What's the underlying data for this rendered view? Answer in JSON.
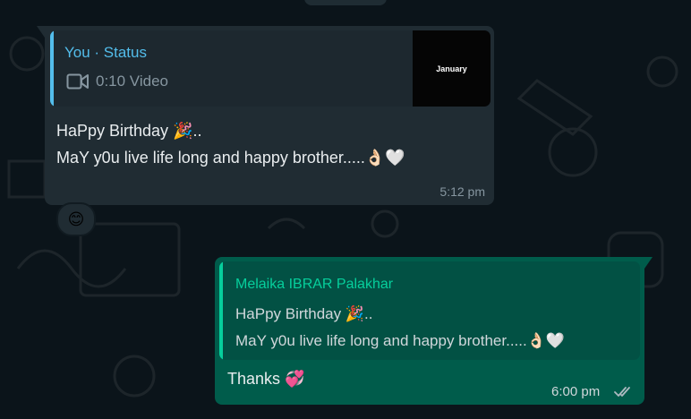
{
  "incoming": {
    "status_quote": {
      "author": "You · Status",
      "media_label": "0:10 Video",
      "thumbnail_text": "January",
      "icon": "video-camera-icon"
    },
    "lines": [
      "HaPpy Birthday 🎉..",
      "MaY y0u live life long and happy brother.....👌🏻🤍"
    ],
    "time": "5:12 pm",
    "reaction": "😊"
  },
  "outgoing": {
    "quote": {
      "author": "Melaika IBRAR Palakhar",
      "lines": [
        "HaPpy Birthday 🎉..",
        "MaY y0u live life long and happy brother.....👌🏻🤍"
      ]
    },
    "text": "Thanks 💞",
    "time": "6:00 pm",
    "status_icon": "double-check-icon"
  },
  "colors": {
    "background": "#0b141a",
    "incoming_bubble": "#202c33",
    "outgoing_bubble": "#005c4b",
    "status_accent": "#53bdeb",
    "quote_accent": "#06cf9c"
  }
}
